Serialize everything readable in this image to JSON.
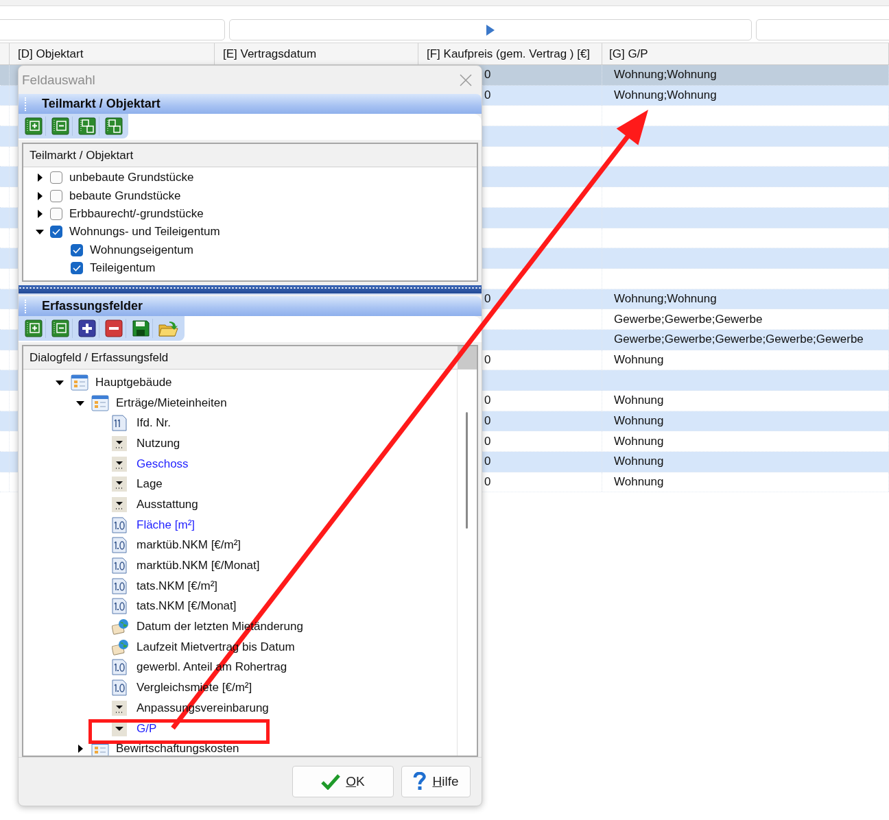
{
  "grid": {
    "columns": [
      {
        "label": "[D] Objektart"
      },
      {
        "label": "[E] Vertragsdatum"
      },
      {
        "label": "[F] Kaufpreis (gem. Vertrag ) [€]"
      },
      {
        "label": "[G] G/P"
      }
    ],
    "rows": [
      {
        "selected": true,
        "f": "0",
        "g": "Wohnung;Wohnung"
      },
      {
        "selected": false,
        "f": "0",
        "g": "Wohnung;Wohnung"
      },
      {
        "selected": false
      },
      {
        "selected": false
      },
      {
        "selected": false
      },
      {
        "selected": false
      },
      {
        "selected": false
      },
      {
        "selected": false
      },
      {
        "selected": false
      },
      {
        "selected": false
      },
      {
        "selected": false
      },
      {
        "selected": false,
        "f": "0",
        "g": "Wohnung;Wohnung"
      },
      {
        "selected": false,
        "g": "Gewerbe;Gewerbe;Gewerbe"
      },
      {
        "selected": false,
        "g": "Gewerbe;Gewerbe;Gewerbe;Gewerbe;Gewerbe"
      },
      {
        "selected": false,
        "f": "0",
        "g": "Wohnung"
      },
      {
        "selected": false
      },
      {
        "selected": false,
        "f": "0",
        "g": "Wohnung"
      },
      {
        "selected": false,
        "f": "0",
        "g": "Wohnung"
      },
      {
        "selected": false,
        "f": "0",
        "g": "Wohnung"
      },
      {
        "selected": false,
        "f": "0",
        "g": "Wohnung"
      },
      {
        "selected": false,
        "f": "0",
        "g": "Wohnung"
      }
    ]
  },
  "dialog": {
    "title": "Feldauswahl",
    "sections": [
      {
        "title": "Teilmarkt / Objektart",
        "tree_header": "Teilmarkt / Objektart",
        "items": [
          {
            "label": "unbebaute Grundstücke",
            "expanded": false,
            "checked": false
          },
          {
            "label": "bebaute Grundstücke",
            "expanded": false,
            "checked": false
          },
          {
            "label": "Erbbaurecht/-grundstücke",
            "expanded": false,
            "checked": false
          },
          {
            "label": "Wohnungs- und Teileigentum",
            "expanded": true,
            "checked": true,
            "children": [
              {
                "label": "Wohnungseigentum",
                "checked": true
              },
              {
                "label": "Teileigentum",
                "checked": true
              }
            ]
          }
        ]
      },
      {
        "title": "Erfassungsfelder",
        "tree_header": "Dialogfeld / Erfassungsfeld",
        "items": [
          {
            "label": "Hauptgebäude",
            "kind": "form",
            "expanded": true,
            "children": [
              {
                "label": "Erträge/Mieteinheiten",
                "kind": "form",
                "expanded": true,
                "children": [
                  {
                    "label": "Ifd. Nr.",
                    "kind": "integer"
                  },
                  {
                    "label": "Nutzung",
                    "kind": "choice"
                  },
                  {
                    "label": "Geschoss",
                    "kind": "choice",
                    "color": "#1f1fff"
                  },
                  {
                    "label": "Lage",
                    "kind": "choice"
                  },
                  {
                    "label": "Ausstattung",
                    "kind": "choice"
                  },
                  {
                    "label": "Fläche [m²]",
                    "kind": "decimal",
                    "color": "#1f1fff"
                  },
                  {
                    "label": "marktüb.NKM [€/m²]",
                    "kind": "decimal"
                  },
                  {
                    "label": "marktüb.NKM [€/Monat]",
                    "kind": "decimal"
                  },
                  {
                    "label": "tats.NKM [€/m²]",
                    "kind": "decimal"
                  },
                  {
                    "label": "tats.NKM [€/Monat]",
                    "kind": "decimal"
                  },
                  {
                    "label": "Datum der letzten Mietänderung",
                    "kind": "date"
                  },
                  {
                    "label": "Laufzeit Mietvertrag bis Datum",
                    "kind": "date"
                  },
                  {
                    "label": "gewerbl. Anteil am Rohertrag",
                    "kind": "decimal"
                  },
                  {
                    "label": "Vergleichsmiete [€/m²]",
                    "kind": "decimal"
                  },
                  {
                    "label": "Anpassungsvereinbarung",
                    "kind": "choice"
                  },
                  {
                    "label": "G/P",
                    "kind": "dropdown",
                    "color": "#1f1fff"
                  }
                ]
              },
              {
                "label": "Bewirtschaftungskosten",
                "kind": "form",
                "expanded": false
              }
            ]
          }
        ]
      }
    ],
    "buttons": [
      {
        "label": "OK",
        "kind": "ok",
        "mnemonic_underlined": true
      },
      {
        "label": "Hilfe",
        "kind": "help",
        "mnemonic_underlined": true
      }
    ]
  },
  "annotations": [
    {
      "kind": "arrow"
    },
    {
      "kind": "frame"
    }
  ]
}
